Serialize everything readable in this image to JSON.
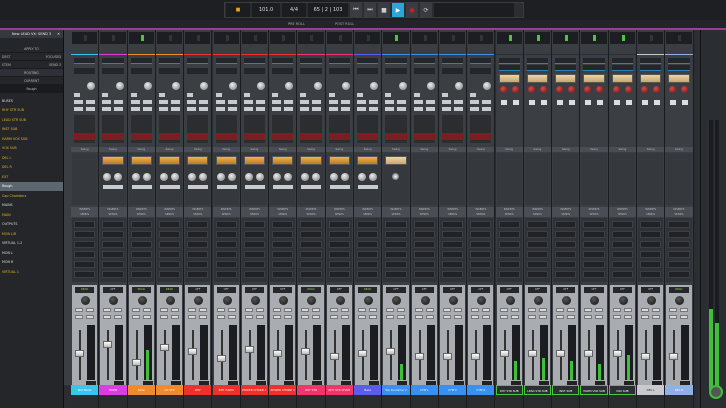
{
  "transport": {
    "tempo": "101.0",
    "time_sig": "4/4",
    "location": "65 | 2 | 103",
    "pre_roll": "PRE ROLL",
    "post_roll": "POST ROLL"
  },
  "left_panel": {
    "title": "New LEAD VX: SEND 3",
    "apply_to": "APPLY TO",
    "dest_label": "DEST",
    "dest_value": "FOCUSED",
    "stem_label": "STEM",
    "stem_value": "SEND 3",
    "routing": "ROUTING",
    "current": "CURRENT",
    "current_value": "Rough",
    "items": [
      {
        "label": "BUSES",
        "color": "#dddddd"
      },
      {
        "label": "RHY STR SUB",
        "color": "#e0b41e"
      },
      {
        "label": "LEAD STR SUB",
        "color": "#e0b41e"
      },
      {
        "label": "INST SUB",
        "color": "#e0b41e"
      },
      {
        "label": "HARM VOX SUB",
        "color": "#e0b41e"
      },
      {
        "label": "VOX SUB",
        "color": "#e0b41e"
      },
      {
        "label": "DEL L",
        "color": "#e0b41e"
      },
      {
        "label": "DEL R",
        "color": "#e0b41e"
      },
      {
        "label": "EXT",
        "color": "#e0b41e"
      },
      {
        "label": "Rough",
        "color": "#e0b41e",
        "selected": true
      },
      {
        "label": "Cap Chambers",
        "color": "#e0b41e"
      },
      {
        "label": "MAINS",
        "color": "#dddddd"
      },
      {
        "label": "MAIN",
        "color": "#e0b41e"
      },
      {
        "label": "OUTPUTS",
        "color": "#dddddd"
      },
      {
        "label": "MON L/R",
        "color": "#e0b41e"
      },
      {
        "label": "VIRTUAL 1-2",
        "color": "#dddddd"
      },
      {
        "label": "MON L",
        "color": "#dddddd"
      },
      {
        "label": "MON R",
        "color": "#dddddd"
      },
      {
        "label": "VIRTUAL 1",
        "color": "#e0b41e"
      }
    ]
  },
  "labels": {
    "insert_label": "Swing",
    "inserts": "INSERTS",
    "sends": "SENDS",
    "auto_read": "READ",
    "auto_off": "OFF",
    "mute": "M",
    "solo": "S"
  },
  "channels": [
    {
      "name": "Bot Maria",
      "color": "#38c6ef",
      "auto": "READ",
      "level": 0.0,
      "fader": 0.55,
      "plugin": "none"
    },
    {
      "name": "HARM",
      "color": "#d93fe0",
      "auto": "OFF",
      "level": 0.0,
      "fader": 0.75,
      "plugin": "comp"
    },
    {
      "name": "Slide",
      "color": "#f08a2c",
      "auto": "READ",
      "level": 0.55,
      "fader": 0.35,
      "plugin": "comp"
    },
    {
      "name": "LD STR",
      "color": "#f08a2c",
      "auto": "READ",
      "level": 0.0,
      "fader": 0.7,
      "plugin": "comp"
    },
    {
      "name": "RHY",
      "color": "#f0302e",
      "auto": "OFF",
      "level": 0.0,
      "fader": 0.6,
      "plugin": "comp"
    },
    {
      "name": "RHY HARM",
      "color": "#f0302e",
      "auto": "OFF",
      "level": 0.0,
      "fader": 0.45,
      "plugin": "comp"
    },
    {
      "name": "POWER CHORD 1",
      "color": "#f0302e",
      "auto": "OFF",
      "level": 0.0,
      "fader": 0.65,
      "plugin": "comp"
    },
    {
      "name": "POWER CHORD 2",
      "color": "#f0302e",
      "auto": "OFF",
      "level": 0.0,
      "fader": 0.55,
      "plugin": "comp"
    },
    {
      "name": "RHY STR",
      "color": "#f23468",
      "auto": "READ",
      "level": 0.0,
      "fader": 0.6,
      "plugin": "comp"
    },
    {
      "name": "RHY STR CHAIR",
      "color": "#f23468",
      "auto": "OFF",
      "level": 0.0,
      "fader": 0.5,
      "plugin": "comp"
    },
    {
      "name": "Bass",
      "color": "#5a5cf0",
      "auto": "READ",
      "level": 0.0,
      "fader": 0.55,
      "plugin": "comp"
    },
    {
      "name": "Top Drummer 2",
      "color": "#3a8ff0",
      "auto": "OFF",
      "level": 0.3,
      "fader": 0.6,
      "plugin": "vu"
    },
    {
      "name": "CYM L",
      "color": "#3a8ff0",
      "auto": "OFF",
      "level": 0.0,
      "fader": 0.5,
      "plugin": "none"
    },
    {
      "name": "CYM C",
      "color": "#3a8ff0",
      "auto": "OFF",
      "level": 0.0,
      "fader": 0.5,
      "plugin": "none"
    },
    {
      "name": "CYM R",
      "color": "#3a8ff0",
      "auto": "OFF",
      "level": 0.0,
      "fader": 0.5,
      "plugin": "none"
    },
    {
      "name": "RHY STR SUB",
      "color": "#2b2e33",
      "auto": "OFF",
      "level": 0.35,
      "fader": 0.55,
      "plugin": "bus"
    },
    {
      "name": "LEAD STR SUB",
      "color": "#2b2e33",
      "auto": "OFF",
      "level": 0.4,
      "fader": 0.55,
      "plugin": "bus"
    },
    {
      "name": "INST SUB",
      "color": "#2b2e33",
      "auto": "OFF",
      "level": 0.35,
      "fader": 0.55,
      "plugin": "bus"
    },
    {
      "name": "HARM VOX SUB",
      "color": "#2b2e33",
      "auto": "OFF",
      "level": 0.3,
      "fader": 0.55,
      "plugin": "bus"
    },
    {
      "name": "VOX SUB",
      "color": "#2b2e33",
      "auto": "OFF",
      "level": 0.45,
      "fader": 0.55,
      "plugin": "bus"
    },
    {
      "name": "DEL L",
      "color": "#c8cacd",
      "auto": "OFF",
      "level": 0.0,
      "fader": 0.5,
      "plugin": "bus"
    },
    {
      "name": "DEL R",
      "color": "#8fb1e6",
      "auto": "READ",
      "level": 0.0,
      "fader": 0.5,
      "plugin": "bus"
    }
  ],
  "master": {
    "level_l": 0.3,
    "level_r": 0.25
  }
}
